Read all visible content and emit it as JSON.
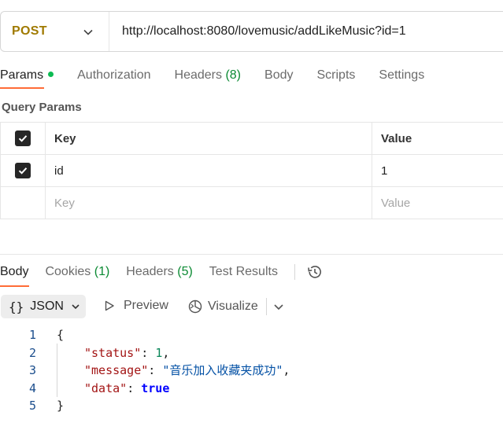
{
  "request": {
    "method": "POST",
    "url": "http://localhost:8080/lovemusic/addLikeMusic?id=1"
  },
  "request_tabs": {
    "params": "Params",
    "authorization": "Authorization",
    "headers": "Headers",
    "headers_count": "(8)",
    "body": "Body",
    "scripts": "Scripts",
    "settings": "Settings"
  },
  "query_params": {
    "title": "Query Params",
    "columns": {
      "key": "Key",
      "value": "Value"
    },
    "rows": [
      {
        "key": "id",
        "value": "1",
        "checked": true
      }
    ],
    "placeholder": {
      "key": "Key",
      "value": "Value"
    }
  },
  "response_tabs": {
    "body": "Body",
    "cookies": "Cookies",
    "cookies_count": "(1)",
    "headers": "Headers",
    "headers_count": "(5)",
    "test_results": "Test Results"
  },
  "response_toolbar": {
    "format_icon": "{}",
    "format": "JSON",
    "preview": "Preview",
    "visualize": "Visualize"
  },
  "response_body": {
    "line_numbers": [
      "1",
      "2",
      "3",
      "4",
      "5"
    ],
    "open_brace": "{",
    "close_brace": "}",
    "key_status": "\"status\"",
    "val_status": "1",
    "key_message": "\"message\"",
    "val_message": "\"音乐加入收藏夹成功\"",
    "key_data": "\"data\"",
    "val_data": "true"
  },
  "colors": {
    "method": "#a07a00",
    "accent": "#ff6c37",
    "count_green": "#0b8a33"
  }
}
